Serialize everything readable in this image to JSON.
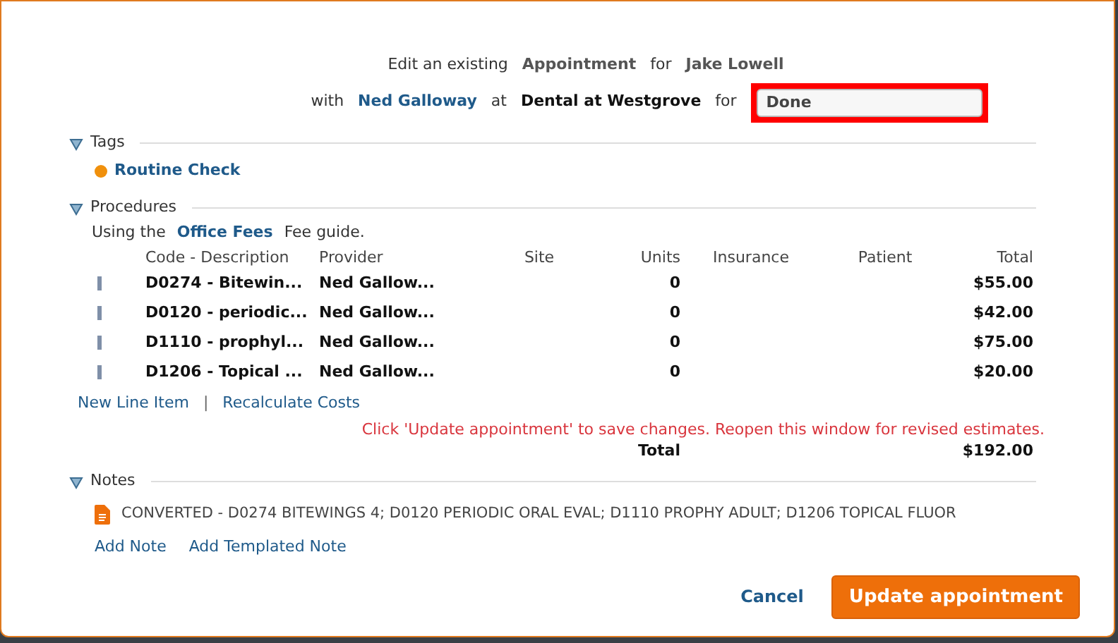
{
  "header": {
    "line1": [
      {
        "text": "Edit an existing",
        "kind": "plain"
      },
      {
        "text": "Appointment",
        "kind": "strong"
      },
      {
        "text": "for",
        "kind": "plain"
      },
      {
        "text": "Jake Lowell",
        "kind": "strong"
      }
    ],
    "line2": [
      {
        "text": "with",
        "kind": "plain"
      },
      {
        "text": "Ned Galloway",
        "kind": "link"
      },
      {
        "text": "at",
        "kind": "plain"
      },
      {
        "text": "Dental at Westgrove",
        "kind": "dark"
      },
      {
        "text": "for",
        "kind": "plain"
      }
    ],
    "status_field": {
      "value": "Done",
      "highlighted": true
    }
  },
  "sections": [
    {
      "title": "Tags",
      "expanded": true,
      "kind": "tags",
      "tags": [
        {
          "label": "Routine Check",
          "color": "#f0900c"
        }
      ]
    },
    {
      "title": "Procedures",
      "expanded": true,
      "kind": "procedures",
      "fee_guide": {
        "before": "Using the",
        "link": "Office Fees",
        "after": "Fee guide."
      },
      "columns": [
        "Code - Description",
        "Provider",
        "Site",
        "Units",
        "Insurance",
        "Patient",
        "Total"
      ],
      "rows": [
        {
          "code": "D0274 - Bitewin...",
          "provider": "Ned Gallow...",
          "units": "0",
          "total": "$55.00"
        },
        {
          "code": "D0120 - periodic...",
          "provider": "Ned Gallow...",
          "units": "0",
          "total": "$42.00"
        },
        {
          "code": "D1110 - prophyl...",
          "provider": "Ned Gallow...",
          "units": "0",
          "total": "$75.00"
        },
        {
          "code": "D1206 - Topical ...",
          "provider": "Ned Gallow...",
          "units": "0",
          "total": "$20.00"
        }
      ],
      "links": [
        "New Line Item",
        "Recalculate Costs"
      ],
      "separator": "|",
      "warning": "Click 'Update appointment' to save changes. Reopen this window for revised estimates.",
      "total_label": "Total",
      "total_value": "$192.00"
    },
    {
      "title": "Notes",
      "expanded": true,
      "kind": "notes",
      "notes": [
        "CONVERTED - D0274 BITEWINGS 4; D0120 PERIODIC ORAL EVAL; D1110 PROPHY ADULT; D1206 TOPICAL FLUOR"
      ],
      "links": [
        "Add Note",
        "Add Templated Note"
      ]
    }
  ],
  "buttons": {
    "cancel": "Cancel",
    "submit": "Update appointment"
  }
}
